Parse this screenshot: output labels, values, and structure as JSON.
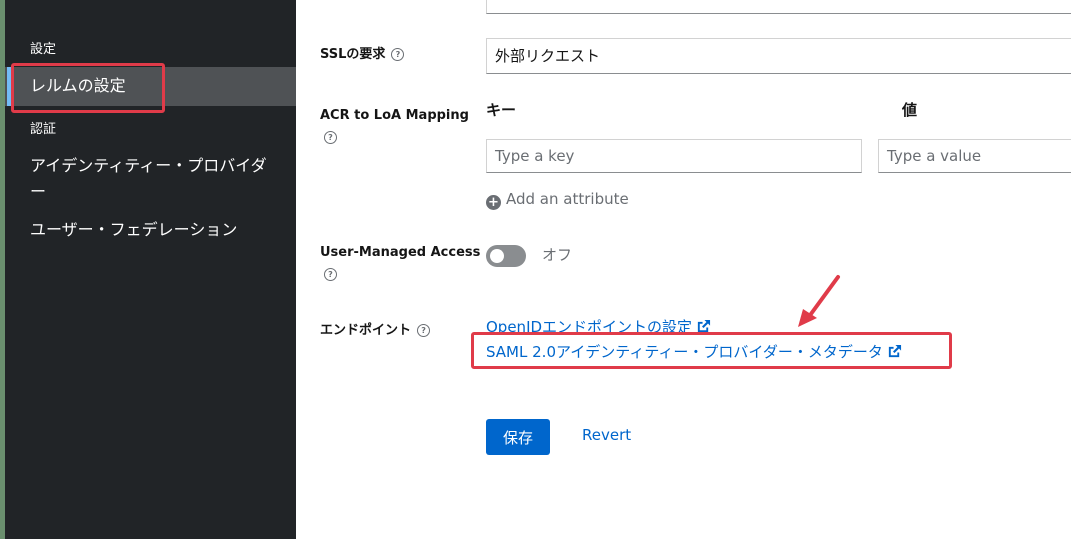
{
  "sidebar": {
    "section_settings": "設定",
    "active_item": "レルムの設定",
    "section_auth": "認証",
    "items": [
      {
        "label": "アイデンティティー・プロバイダー"
      },
      {
        "label": "ユーザー・フェデレーション"
      }
    ]
  },
  "form": {
    "ssl": {
      "label": "SSLの要求",
      "value": "外部リクエスト"
    },
    "acr": {
      "label": "ACR to LoA Mapping",
      "key_header": "キー",
      "value_header": "値",
      "key_placeholder": "Type a key",
      "value_placeholder": "Type a value",
      "add_attribute": "Add an attribute"
    },
    "uma": {
      "label": "User-Managed Access",
      "toggle_state": "オフ"
    },
    "endpoints": {
      "label": "エンドポイント",
      "openid_link": "OpenIDエンドポイントの設定",
      "saml_link": "SAML 2.0アイデンティティー・プロバイダー・メタデータ"
    }
  },
  "actions": {
    "save": "保存",
    "revert": "Revert"
  },
  "colors": {
    "sidebar_bg": "#212427",
    "active_bg": "#4f5255",
    "link": "#06c",
    "highlight": "#e03b49"
  }
}
